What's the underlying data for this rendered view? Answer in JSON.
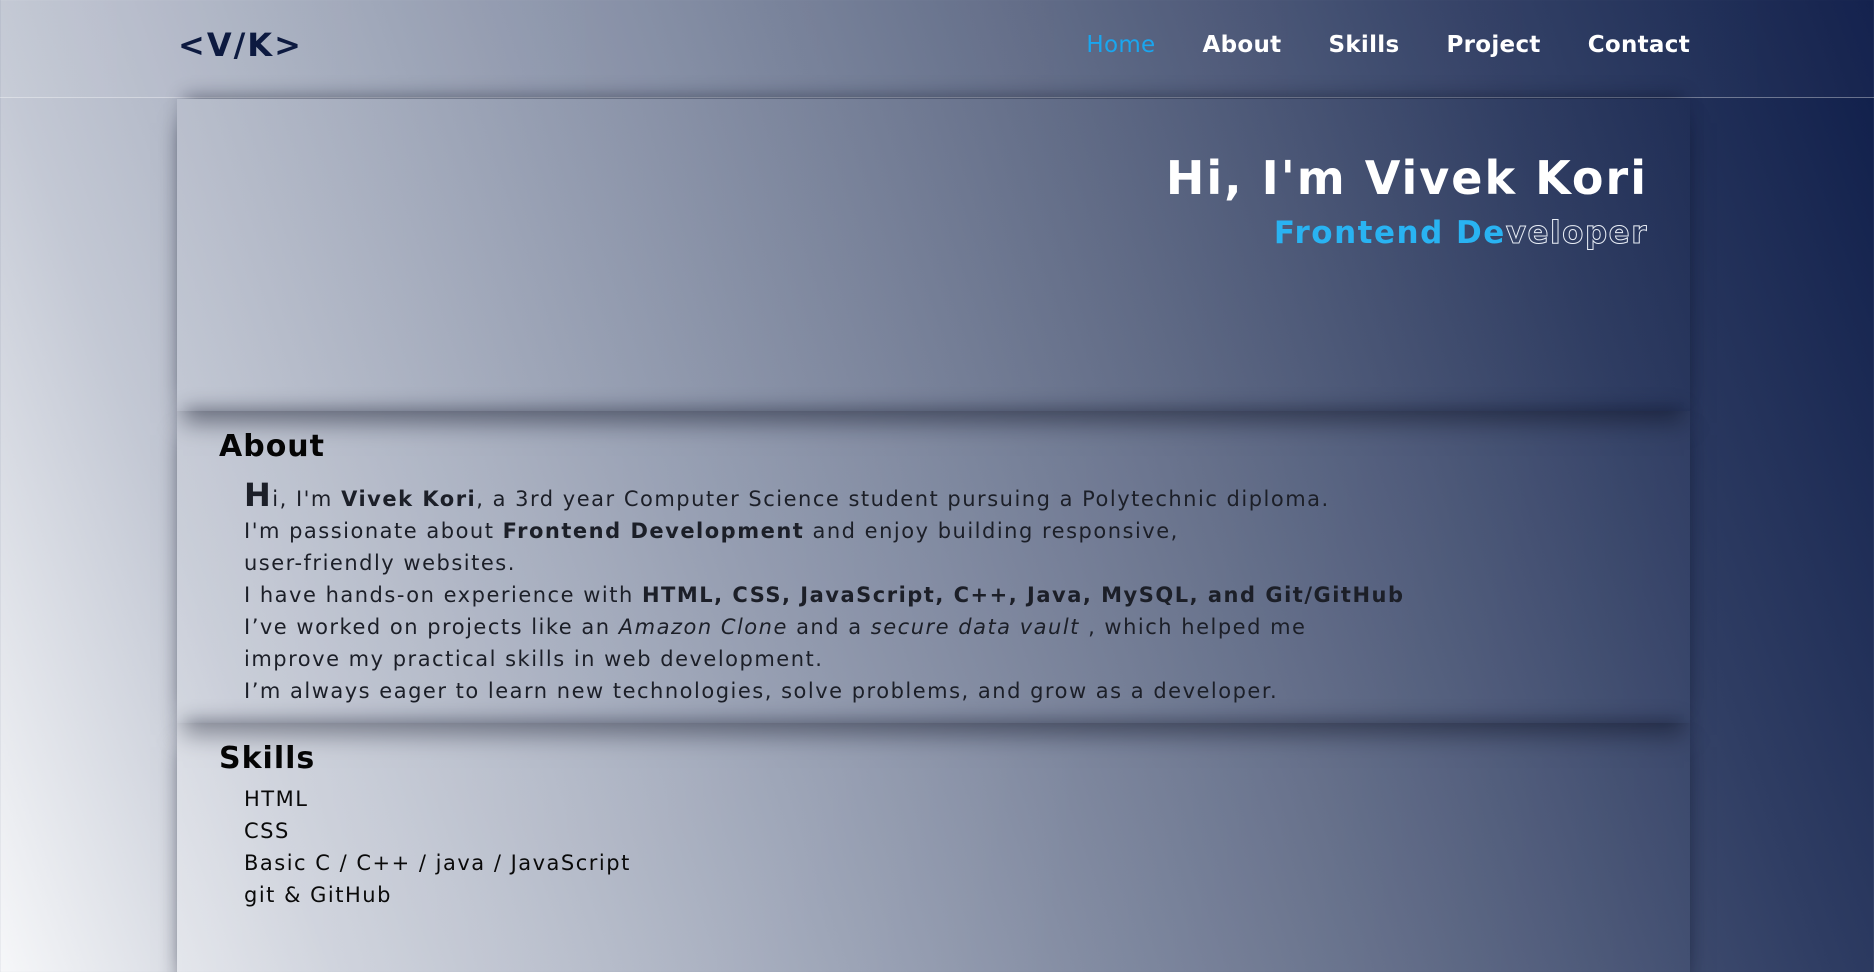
{
  "nav": {
    "logo": "<V/K>",
    "links": [
      "Home",
      "About",
      "Skills",
      "Project",
      "Contact"
    ],
    "active": "Home"
  },
  "hero": {
    "title": "Hi, I'm Vivek Kori",
    "subtitle_typed": "Frontend De",
    "subtitle_rest": "veloper"
  },
  "about": {
    "heading": "About",
    "line1": {
      "cap": "H",
      "a": "i, I'm ",
      "name": "Vivek Kori",
      "b": ", a 3rd year Computer Science student pursuing a Polytechnic diploma."
    },
    "line2": {
      "a": "I'm passionate about ",
      "bold": "Frontend Development",
      "b": " and enjoy building responsive,"
    },
    "line3": "user-friendly websites.",
    "line4": {
      "a": "I have hands-on experience with ",
      "bold": "HTML, CSS, JavaScript, C++, Java, MySQL, and Git/GitHub"
    },
    "line5": {
      "a": "I’ve worked on projects like an ",
      "i1": "Amazon Clone",
      "b": " and a ",
      "i2": "secure data vault",
      "c": " , which helped me"
    },
    "line6": "improve my practical skills in web development.",
    "line7": "I’m always eager to learn new technologies, solve problems, and grow as a developer."
  },
  "skills": {
    "heading": "Skills",
    "items": [
      "HTML",
      "CSS",
      "Basic C / C++ / java / JavaScript",
      "git & GitHub"
    ]
  },
  "colors": {
    "accent": "#1aa6ef",
    "logo": "#0d1a40",
    "bg_dark": "#0f1e4a",
    "bg_light": "#f6f7f9"
  }
}
